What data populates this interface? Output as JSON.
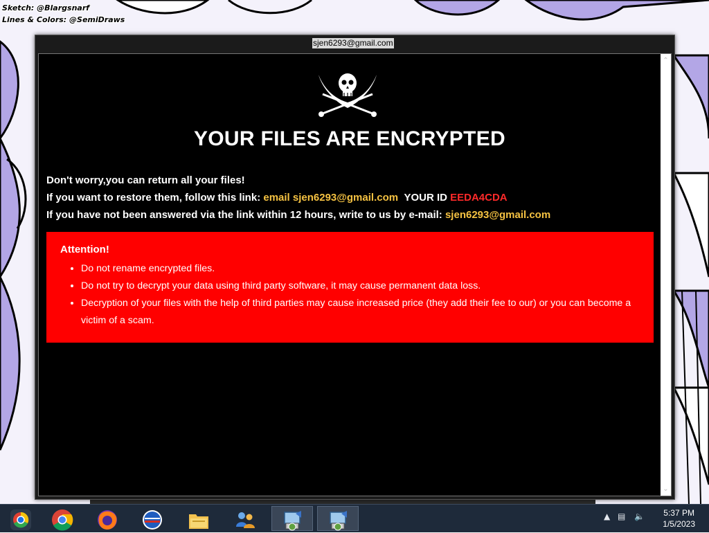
{
  "wallpaper": {
    "credit_line1": "Sketch: @Blargsnarf",
    "credit_line2": "Lines & Colors: @SemiDraws"
  },
  "window": {
    "title": "sjen6293@gmail.com",
    "headline": "YOUR FILES ARE ENCRYPTED",
    "line1": "Don't worry,you can return all your files!",
    "line2_prefix": "If you want to restore them, follow this link: ",
    "line2_email_label": "email sjen6293@gmail.com",
    "line2_id_label": "YOUR ID",
    "line2_id_value": "EEDA4CDA",
    "line3_prefix": "If you have not been answered via the link within 12 hours, write to us by e-mail: ",
    "line3_email": "sjen6293@gmail.com",
    "attention_title": "Attention!",
    "attention_items": [
      "Do not rename encrypted files.",
      "Do not try to decrypt your data using third party software, it may cause permanent data loss.",
      "Decryption of your files with the help of third parties may cause increased price (they add their fee to our) or you can become a victim of a scam."
    ]
  },
  "taskbar": {
    "items": [
      "start-button",
      "chrome-icon",
      "firefox-icon",
      "opera-icon",
      "file-explorer-icon",
      "network-people-icon",
      "installer-icon",
      "installer-icon"
    ],
    "clock_time": "5:37 PM",
    "clock_date": "1/5/2023"
  },
  "colors": {
    "highlight": "#f5c242",
    "id": "#ff2a2a",
    "attention_bg": "#ff0000",
    "window_bg": "#000000",
    "taskbar_bg": "#1e2a3a"
  }
}
